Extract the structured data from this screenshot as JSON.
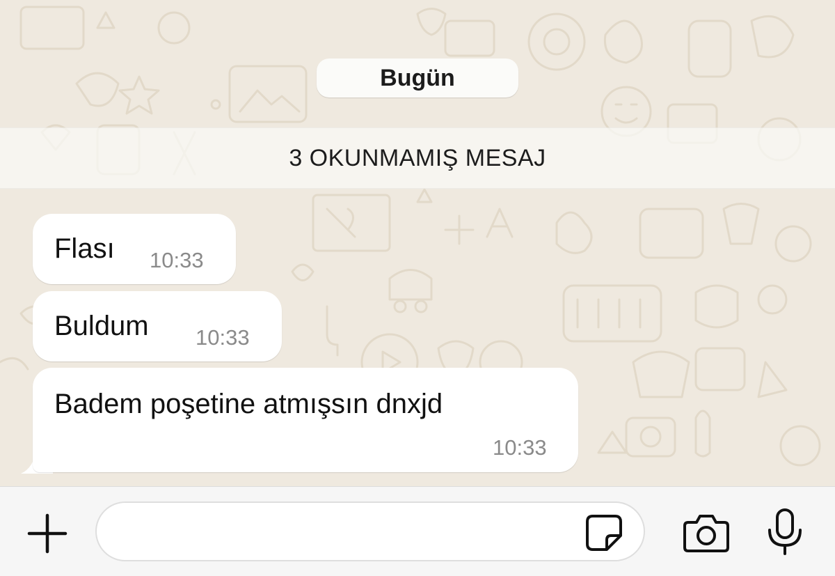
{
  "chat": {
    "date_label": "Bugün",
    "unread_label": "3 OKUNMAMIŞ MESAJ",
    "messages": [
      {
        "text": "Flası",
        "time": "10:33"
      },
      {
        "text": "Buldum",
        "time": "10:33"
      },
      {
        "text": "Badem poşetine atmışsın dnxjd",
        "time": "10:33"
      }
    ]
  },
  "composer": {
    "input_value": "",
    "input_placeholder": "",
    "icons": [
      "plus-icon",
      "sticker-icon",
      "camera-icon",
      "microphone-icon"
    ]
  },
  "colors": {
    "chat_background": "#efe9df",
    "bubble": "#ffffff",
    "composer_bar": "#f6f6f6",
    "timestamp": "#8a8a8a"
  }
}
